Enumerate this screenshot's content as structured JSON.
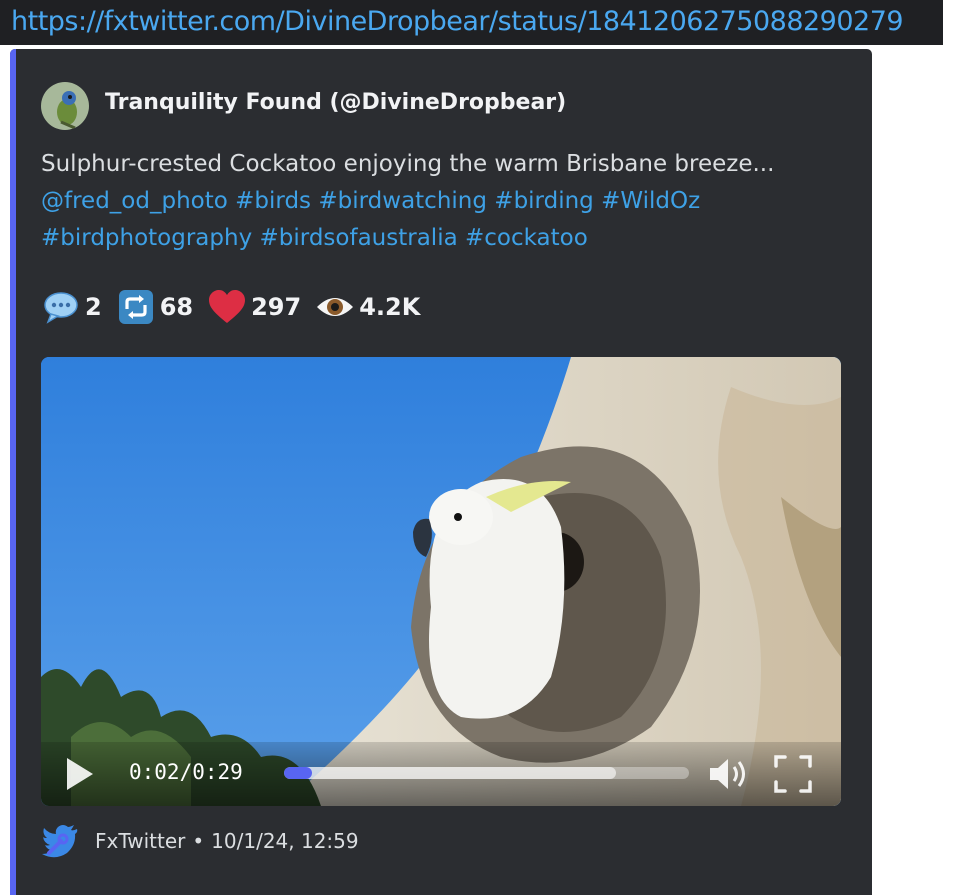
{
  "url": "https://fxtwitter.com/DivineDropbear/status/1841206275088290279",
  "embed": {
    "accent_color": "#5865f2",
    "author": "Tranquility Found (@DivineDropbear)",
    "text": {
      "line1": "Sulphur-crested Cockatoo enjoying the warm Brisbane breeze...",
      "line2_links": [
        "@fred_od_photo",
        "#birds",
        "#birdwatching",
        "#birding",
        "#WildOz"
      ],
      "line3_links": [
        "#birdphotography",
        "#birdsofaustralia",
        "#cockatoo"
      ]
    },
    "stats": [
      {
        "icon": "speech-bubble-icon",
        "value": "2"
      },
      {
        "icon": "retweet-icon",
        "value": "68"
      },
      {
        "icon": "heart-icon",
        "value": "297"
      },
      {
        "icon": "eye-icon",
        "value": "4.2K"
      }
    ],
    "video": {
      "current_time": "0:02",
      "separator": "/",
      "duration": "0:29",
      "played_fraction": 0.07,
      "buffered_fraction": 0.82
    },
    "footer": {
      "provider": "FxTwitter",
      "separator": "•",
      "timestamp": "10/1/24, 12:59"
    }
  }
}
